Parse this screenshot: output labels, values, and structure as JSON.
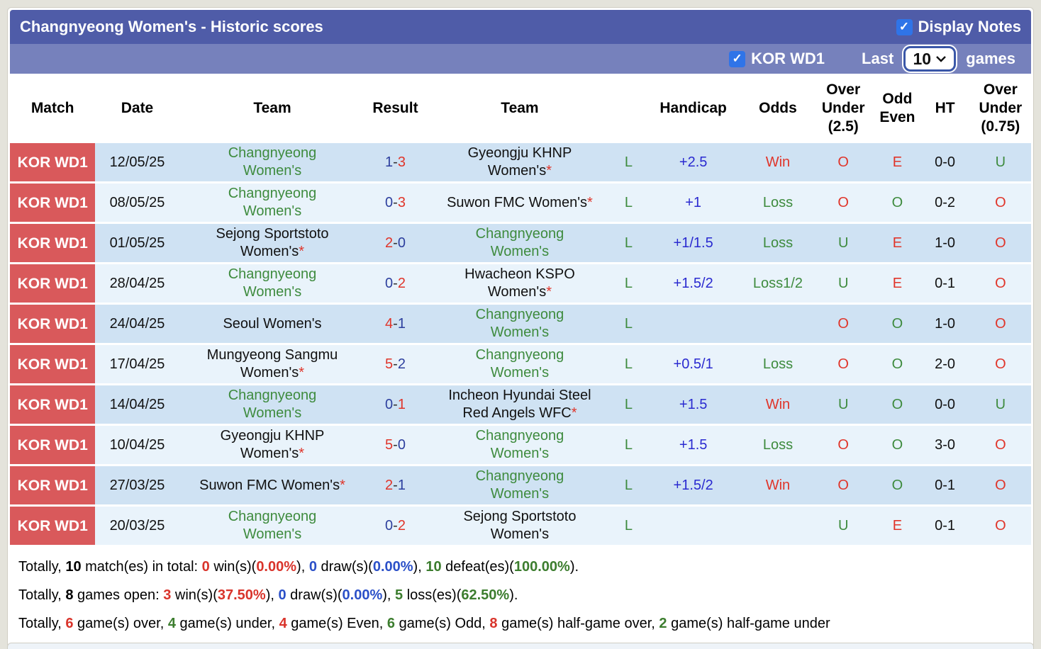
{
  "colors": {
    "accent_bar": "#4f5ca8",
    "filter_bar": "#7681bc",
    "badge_red": "#d9595b",
    "row_blue": "#cfe2f3",
    "row_light": "#e9f3fb",
    "team_green": "#3e8b3e",
    "score_blue": "#2d3f9e",
    "handicap_blue": "#2a2ad0",
    "status_red": "#e0352a",
    "summary_red": "#d9342b",
    "summary_blue": "#2b50c8",
    "summary_green": "#3c7d2e",
    "checkbox_blue": "#2f74e8"
  },
  "header": {
    "title": "Changnyeong Women's - Historic scores",
    "display_notes_label": "Display Notes",
    "league_label": "KOR WD1",
    "last_label": "Last",
    "games_count": "10",
    "games_label": "games"
  },
  "table": {
    "separator": "-",
    "columns": [
      "Match",
      "Date",
      "Team",
      "Result",
      "Team",
      "",
      "Handicap",
      "Odds",
      "Over\nUnder\n(2.5)",
      "Odd\nEven",
      "HT",
      "Over\nUnder\n(0.75)"
    ]
  },
  "rows": [
    {
      "league": "KOR WD1",
      "date": "12/05/25",
      "home": "Changnyeong Women's",
      "home_star": "",
      "home_color": "green",
      "score_home": "1",
      "score_home_color": "blue",
      "score_away": "3",
      "score_away_color": "red",
      "away": "Gyeongju KHNP Women's",
      "away_star": "*",
      "away_color": "black",
      "lwd": "L",
      "lwd_color": "green",
      "handicap": "+2.5",
      "odds": "Win",
      "odds_color": "red",
      "ou25": "O",
      "ou25_color": "red",
      "oddeven": "E",
      "oddeven_color": "red",
      "ht": "0-0",
      "ou075": "U",
      "ou075_color": "green"
    },
    {
      "league": "KOR WD1",
      "date": "08/05/25",
      "home": "Changnyeong Women's",
      "home_star": "",
      "home_color": "green",
      "score_home": "0",
      "score_home_color": "blue",
      "score_away": "3",
      "score_away_color": "red",
      "away": "Suwon FMC Women's",
      "away_star": "*",
      "away_color": "black",
      "lwd": "L",
      "lwd_color": "green",
      "handicap": "+1",
      "odds": "Loss",
      "odds_color": "green",
      "ou25": "O",
      "ou25_color": "red",
      "oddeven": "O",
      "oddeven_color": "green",
      "ht": "0-2",
      "ou075": "O",
      "ou075_color": "red"
    },
    {
      "league": "KOR WD1",
      "date": "01/05/25",
      "home": "Sejong Sportstoto Women's",
      "home_star": "*",
      "home_color": "black",
      "score_home": "2",
      "score_home_color": "red",
      "score_away": "0",
      "score_away_color": "blue",
      "away": "Changnyeong Women's",
      "away_star": "",
      "away_color": "green",
      "lwd": "L",
      "lwd_color": "green",
      "handicap": "+1/1.5",
      "odds": "Loss",
      "odds_color": "green",
      "ou25": "U",
      "ou25_color": "green",
      "oddeven": "E",
      "oddeven_color": "red",
      "ht": "1-0",
      "ou075": "O",
      "ou075_color": "red"
    },
    {
      "league": "KOR WD1",
      "date": "28/04/25",
      "home": "Changnyeong Women's",
      "home_star": "",
      "home_color": "green",
      "score_home": "0",
      "score_home_color": "blue",
      "score_away": "2",
      "score_away_color": "red",
      "away": "Hwacheon KSPO Women's",
      "away_star": "*",
      "away_color": "black",
      "lwd": "L",
      "lwd_color": "green",
      "handicap": "+1.5/2",
      "odds": "Loss1/2",
      "odds_color": "green",
      "ou25": "U",
      "ou25_color": "green",
      "oddeven": "E",
      "oddeven_color": "red",
      "ht": "0-1",
      "ou075": "O",
      "ou075_color": "red"
    },
    {
      "league": "KOR WD1",
      "date": "24/04/25",
      "home": "Seoul Women's",
      "home_star": "",
      "home_color": "black",
      "score_home": "4",
      "score_home_color": "red",
      "score_away": "1",
      "score_away_color": "blue",
      "away": "Changnyeong Women's",
      "away_star": "",
      "away_color": "green",
      "lwd": "L",
      "lwd_color": "green",
      "handicap": "",
      "odds": "",
      "odds_color": "black",
      "ou25": "O",
      "ou25_color": "red",
      "oddeven": "O",
      "oddeven_color": "green",
      "ht": "1-0",
      "ou075": "O",
      "ou075_color": "red"
    },
    {
      "league": "KOR WD1",
      "date": "17/04/25",
      "home": "Mungyeong Sangmu Women's",
      "home_star": "*",
      "home_color": "black",
      "score_home": "5",
      "score_home_color": "red",
      "score_away": "2",
      "score_away_color": "blue",
      "away": "Changnyeong Women's",
      "away_star": "",
      "away_color": "green",
      "lwd": "L",
      "lwd_color": "green",
      "handicap": "+0.5/1",
      "odds": "Loss",
      "odds_color": "green",
      "ou25": "O",
      "ou25_color": "red",
      "oddeven": "O",
      "oddeven_color": "green",
      "ht": "2-0",
      "ou075": "O",
      "ou075_color": "red"
    },
    {
      "league": "KOR WD1",
      "date": "14/04/25",
      "home": "Changnyeong Women's",
      "home_star": "",
      "home_color": "green",
      "score_home": "0",
      "score_home_color": "blue",
      "score_away": "1",
      "score_away_color": "red",
      "away": "Incheon Hyundai Steel Red Angels WFC",
      "away_star": "*",
      "away_color": "black",
      "lwd": "L",
      "lwd_color": "green",
      "handicap": "+1.5",
      "odds": "Win",
      "odds_color": "red",
      "ou25": "U",
      "ou25_color": "green",
      "oddeven": "O",
      "oddeven_color": "green",
      "ht": "0-0",
      "ou075": "U",
      "ou075_color": "green"
    },
    {
      "league": "KOR WD1",
      "date": "10/04/25",
      "home": "Gyeongju KHNP Women's",
      "home_star": "*",
      "home_color": "black",
      "score_home": "5",
      "score_home_color": "red",
      "score_away": "0",
      "score_away_color": "blue",
      "away": "Changnyeong Women's",
      "away_star": "",
      "away_color": "green",
      "lwd": "L",
      "lwd_color": "green",
      "handicap": "+1.5",
      "odds": "Loss",
      "odds_color": "green",
      "ou25": "O",
      "ou25_color": "red",
      "oddeven": "O",
      "oddeven_color": "green",
      "ht": "3-0",
      "ou075": "O",
      "ou075_color": "red"
    },
    {
      "league": "KOR WD1",
      "date": "27/03/25",
      "home": "Suwon FMC Women's",
      "home_star": "*",
      "home_color": "black",
      "score_home": "2",
      "score_home_color": "red",
      "score_away": "1",
      "score_away_color": "blue",
      "away": "Changnyeong Women's",
      "away_star": "",
      "away_color": "green",
      "lwd": "L",
      "lwd_color": "green",
      "handicap": "+1.5/2",
      "odds": "Win",
      "odds_color": "red",
      "ou25": "O",
      "ou25_color": "red",
      "oddeven": "O",
      "oddeven_color": "green",
      "ht": "0-1",
      "ou075": "O",
      "ou075_color": "red"
    },
    {
      "league": "KOR WD1",
      "date": "20/03/25",
      "home": "Changnyeong Women's",
      "home_star": "",
      "home_color": "green",
      "score_home": "0",
      "score_home_color": "blue",
      "score_away": "2",
      "score_away_color": "red",
      "away": "Sejong Sportstoto Women's",
      "away_star": "",
      "away_color": "black",
      "lwd": "L",
      "lwd_color": "green",
      "handicap": "",
      "odds": "",
      "odds_color": "black",
      "ou25": "U",
      "ou25_color": "green",
      "oddeven": "E",
      "oddeven_color": "red",
      "ht": "0-1",
      "ou075": "O",
      "ou075_color": "red"
    }
  ],
  "summary": {
    "l1": [
      {
        "t": "Totally, "
      },
      {
        "t": "10",
        "c": "bold"
      },
      {
        "t": " match(es) in total: "
      },
      {
        "t": "0",
        "c": "red"
      },
      {
        "t": " win(s)("
      },
      {
        "t": "0.00%",
        "c": "red"
      },
      {
        "t": "), "
      },
      {
        "t": "0",
        "c": "blue"
      },
      {
        "t": " draw(s)("
      },
      {
        "t": "0.00%",
        "c": "blue"
      },
      {
        "t": "), "
      },
      {
        "t": "10",
        "c": "green"
      },
      {
        "t": " defeat(es)("
      },
      {
        "t": "100.00%",
        "c": "green"
      },
      {
        "t": ")."
      }
    ],
    "l2": [
      {
        "t": "Totally, "
      },
      {
        "t": "8",
        "c": "bold"
      },
      {
        "t": " games open: "
      },
      {
        "t": "3",
        "c": "red"
      },
      {
        "t": " win(s)("
      },
      {
        "t": "37.50%",
        "c": "red"
      },
      {
        "t": "), "
      },
      {
        "t": "0",
        "c": "blue"
      },
      {
        "t": " draw(s)("
      },
      {
        "t": "0.00%",
        "c": "blue"
      },
      {
        "t": "), "
      },
      {
        "t": "5",
        "c": "green"
      },
      {
        "t": " loss(es)("
      },
      {
        "t": "62.50%",
        "c": "green"
      },
      {
        "t": ")."
      }
    ],
    "l3": [
      {
        "t": "Totally, "
      },
      {
        "t": "6",
        "c": "red"
      },
      {
        "t": " game(s) over, "
      },
      {
        "t": "4",
        "c": "green"
      },
      {
        "t": " game(s) under, "
      },
      {
        "t": "4",
        "c": "red"
      },
      {
        "t": " game(s) Even, "
      },
      {
        "t": "6",
        "c": "green"
      },
      {
        "t": " game(s) Odd, "
      },
      {
        "t": "8",
        "c": "red"
      },
      {
        "t": " game(s) half-game over, "
      },
      {
        "t": "2",
        "c": "green"
      },
      {
        "t": " game(s) half-game under"
      }
    ]
  }
}
